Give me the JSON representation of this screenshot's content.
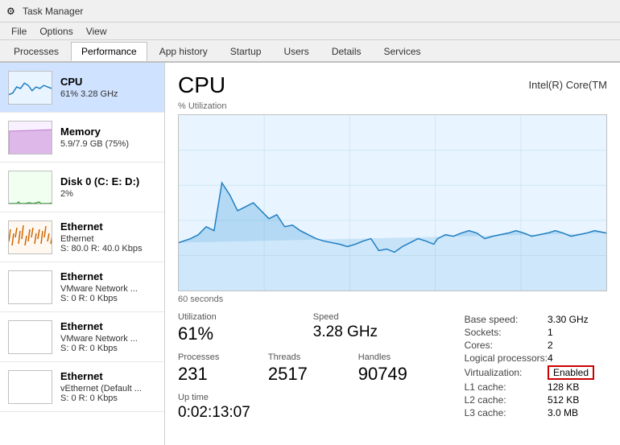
{
  "titleBar": {
    "icon": "⚙",
    "title": "Task Manager"
  },
  "menuBar": {
    "items": [
      "File",
      "Options",
      "View"
    ]
  },
  "tabs": [
    {
      "label": "Processes",
      "active": false
    },
    {
      "label": "Performance",
      "active": true
    },
    {
      "label": "App history",
      "active": false
    },
    {
      "label": "Startup",
      "active": false
    },
    {
      "label": "Users",
      "active": false
    },
    {
      "label": "Details",
      "active": false
    },
    {
      "label": "Services",
      "active": false
    }
  ],
  "sidebar": {
    "items": [
      {
        "title": "CPU",
        "subtitle1": "61% 3.28 GHz",
        "subtitle2": "",
        "type": "cpu",
        "active": true
      },
      {
        "title": "Memory",
        "subtitle1": "5.9/7.9 GB (75%)",
        "subtitle2": "",
        "type": "memory",
        "active": false
      },
      {
        "title": "Disk 0 (C: E: D:)",
        "subtitle1": "2%",
        "subtitle2": "",
        "type": "disk",
        "active": false
      },
      {
        "title": "Ethernet",
        "subtitle1": "Ethernet",
        "subtitle2": "S: 80.0  R: 40.0 Kbps",
        "type": "ethernet1",
        "active": false
      },
      {
        "title": "Ethernet",
        "subtitle1": "VMware Network ...",
        "subtitle2": "S: 0  R: 0 Kbps",
        "type": "ethernet2",
        "active": false
      },
      {
        "title": "Ethernet",
        "subtitle1": "VMware Network ...",
        "subtitle2": "S: 0  R: 0 Kbps",
        "type": "ethernet3",
        "active": false
      },
      {
        "title": "Ethernet",
        "subtitle1": "vEthernet (Default ...",
        "subtitle2": "S: 0  R: 0 Kbps",
        "type": "ethernet4",
        "active": false
      }
    ]
  },
  "mainPanel": {
    "title": "CPU",
    "model": "Intel(R) Core(TM",
    "chartLabel": "% Utilization",
    "chartTimeLabel": "60 seconds",
    "stats": {
      "utilization": {
        "label": "Utilization",
        "value": "61%"
      },
      "speed": {
        "label": "Speed",
        "value": "3.28 GHz"
      },
      "processes": {
        "label": "Processes",
        "value": "231"
      },
      "threads": {
        "label": "Threads",
        "value": "2517"
      },
      "handles": {
        "label": "Handles",
        "value": "90749"
      },
      "uptime": {
        "label": "Up time",
        "value": "0:02:13:07"
      }
    },
    "specs": {
      "baseSpeed": {
        "label": "Base speed:",
        "value": "3.30 GHz"
      },
      "sockets": {
        "label": "Sockets:",
        "value": "1"
      },
      "cores": {
        "label": "Cores:",
        "value": "2"
      },
      "logicalProcessors": {
        "label": "Logical processors:",
        "value": "4"
      },
      "virtualization": {
        "label": "Virtualization:",
        "value": "Enabled"
      },
      "l1cache": {
        "label": "L1 cache:",
        "value": "128 KB"
      },
      "l2cache": {
        "label": "L2 cache:",
        "value": "512 KB"
      },
      "l3cache": {
        "label": "L3 cache:",
        "value": "3.0 MB"
      }
    }
  }
}
